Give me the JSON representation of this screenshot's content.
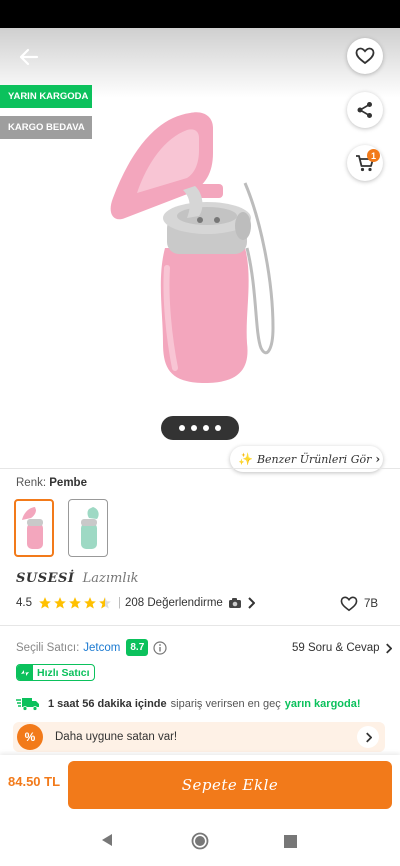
{
  "top_bar": {
    "back_icon": "arrow-left-icon",
    "favorite_icon": "heart-outline-icon",
    "share_icon": "share-icon",
    "cart_icon": "cart-icon",
    "cart_count": "1"
  },
  "tags": {
    "tomorrow_cargo": "YARIN KARGODA",
    "free_cargo": "KARGO BEDAVA"
  },
  "gallery": {
    "page_dots": 4,
    "similar_products": "Benzer Ürünleri Gör"
  },
  "variant": {
    "label": "Renk:",
    "value": "Pembe",
    "options": [
      "Pembe",
      "Yeşil"
    ]
  },
  "product": {
    "brand": "SUSESİ",
    "name": "Lazımlık"
  },
  "rating": {
    "score": "4.5",
    "stars": 4.5,
    "reviews": "208 Değerlendirme",
    "camera_icon": "camera-icon",
    "favorites": "7B"
  },
  "seller": {
    "label": "Seçili Satıcı:",
    "name": "Jetcom",
    "score": "8.7",
    "qa": "59 Soru & Cevap",
    "fast_seller": "Hızlı Satıcı"
  },
  "delivery": {
    "time": "1 saat 56 dakika içinde",
    "middle": "sipariş verirsen en geç",
    "highlight": "yarın kargoda!"
  },
  "cheaper": {
    "text": "Daha uygune satan var!"
  },
  "checkout": {
    "price": "84.50 TL",
    "add_to_cart": "Sepete Ekle"
  },
  "colors": {
    "accent": "#f27a1a",
    "green": "#0bc15c",
    "tag_gray": "#9e9e9e",
    "pink": "#f3a6bd"
  }
}
